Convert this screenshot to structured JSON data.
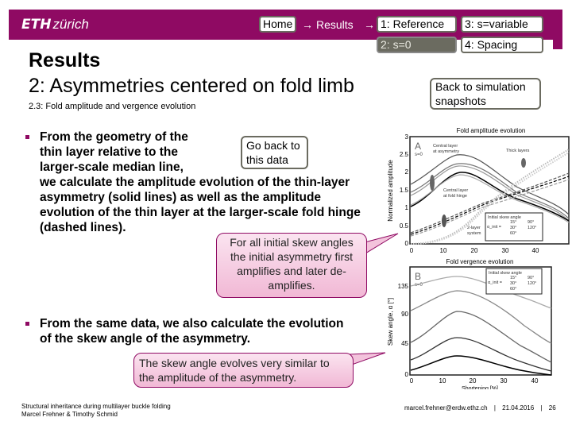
{
  "header": {
    "logo_bold": "ETH",
    "logo_light": "zürich",
    "brand_color": "#8f0a63",
    "nav": {
      "home": "Home",
      "arrow1": "→",
      "results": "Results",
      "arrow2": "→",
      "tabs": [
        {
          "label": "1: Reference",
          "active": false
        },
        {
          "label": "3: s=variable",
          "active": false
        },
        {
          "label": "2: s=0",
          "active": true
        },
        {
          "label": "4: Spacing",
          "active": false
        }
      ]
    }
  },
  "title": {
    "main": "Results",
    "subtitle": "2: Asymmetries centered on fold limb",
    "section": "2.3:  Fold amplitude and vergence evolution"
  },
  "buttons": {
    "back_to_snapshots": [
      "Back to simulation",
      "snapshots"
    ],
    "go_back_data": [
      "Go back to",
      "this data"
    ]
  },
  "bullets": [
    {
      "lines": [
        "From the geometry of the",
        "thin layer relative to the",
        "larger-scale median line,",
        "we calculate the amplitude evolution of the thin-layer",
        "asymmetry (solid lines) as well as the amplitude",
        "evolution of the thin layer at the larger-scale fold hinge",
        "(dashed lines)."
      ]
    },
    {
      "lines": [
        "From the same data, we also calculate the evolution",
        "of the skew angle of the asymmetry."
      ]
    }
  ],
  "callouts": {
    "amplitude": [
      "For all initial skew angles",
      "the initial asymmetry first",
      "amplifies and later de-",
      "amplifies."
    ],
    "skew": [
      "The skew angle evolves very similar to",
      "the amplitude of the asymmetry."
    ]
  },
  "figure": {
    "panel_a": {
      "title": "Fold amplitude evolution",
      "label": "A",
      "s_label": "s=0",
      "ylabel": "Normalized amplitude",
      "yticks": [
        "0",
        "0.5",
        "1",
        "1.5",
        "2",
        "2.5",
        "3"
      ],
      "xticks": [
        "0",
        "10",
        "20",
        "30",
        "40"
      ],
      "annotations": [
        "Central layer",
        "at asymmetry",
        "Thick layers",
        "Central layer",
        "at fold hinge",
        "2-layer",
        "system"
      ],
      "legend_title": "Initial skew angle",
      "legend_sym": "α_init =",
      "legend": [
        "15°",
        "90°",
        "30°",
        "120°",
        "60°"
      ]
    },
    "panel_b": {
      "title": "Fold vergence evolution",
      "label": "B",
      "s_label": "s=0",
      "ylabel": "Skew angle, α [°]",
      "xlabel": "Shortening [%]",
      "yticks": [
        "0",
        "45",
        "90",
        "135"
      ],
      "xticks": [
        "0",
        "10",
        "20",
        "30",
        "40"
      ],
      "legend_title": "Initial skew angle",
      "legend_sym": "α_init =",
      "legend": [
        "15°",
        "90°",
        "30°",
        "120°",
        "60°"
      ]
    }
  },
  "footer": {
    "title": "Structural inheritance during multilayer buckle folding",
    "authors": "Marcel Frehner & Timothy Schmid",
    "email": "marcel.frehner@erdw.ethz.ch",
    "sep1": "|",
    "date": "21.04.2016",
    "sep2": "|",
    "page": "26"
  }
}
